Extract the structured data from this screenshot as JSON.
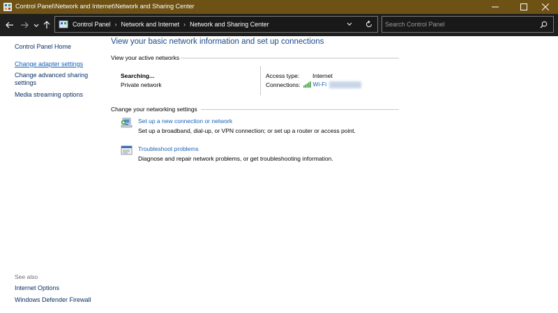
{
  "window": {
    "title": "Control Panel\\Network and Internet\\Network and Sharing Center"
  },
  "address_bar": {
    "breadcrumbs": [
      "Control Panel",
      "Network and Internet",
      "Network and Sharing Center"
    ]
  },
  "search": {
    "placeholder": "Search Control Panel"
  },
  "left_nav": {
    "home": "Control Panel Home",
    "links": [
      "Change adapter settings",
      "Change advanced sharing settings",
      "Media streaming options"
    ],
    "see_also_label": "See also",
    "see_also_links": [
      "Internet Options",
      "Windows Defender Firewall"
    ]
  },
  "main": {
    "heading": "View your basic network information and set up connections",
    "active_networks_label": "View your active networks",
    "network": {
      "name": "Searching...",
      "category": "Private network",
      "access_type_label": "Access type:",
      "access_type_value": "Internet",
      "connections_label": "Connections:",
      "connection_name": "Wi-Fi"
    },
    "settings_label": "Change your networking settings",
    "tasks": [
      {
        "title": "Set up a new connection or network",
        "desc": "Set up a broadband, dial-up, or VPN connection; or set up a router or access point."
      },
      {
        "title": "Troubleshoot problems",
        "desc": "Diagnose and repair network problems, or get troubleshooting information."
      }
    ]
  },
  "colors": {
    "titlebar": "#6e5114",
    "navbar": "#1f1f1f",
    "link": "#1563b8",
    "heading": "#1a4a8a",
    "wifi_bars": "#3aa13a"
  }
}
